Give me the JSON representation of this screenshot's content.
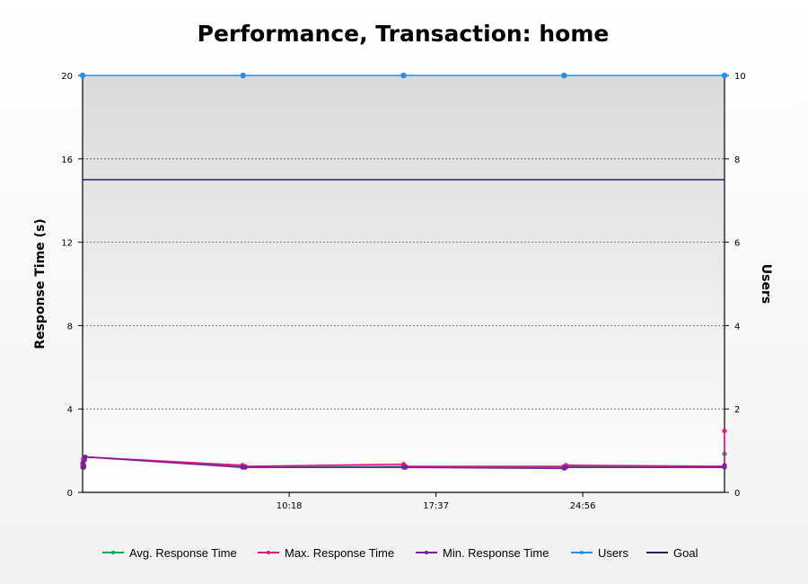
{
  "chart_data": {
    "type": "line",
    "title": "Performance, Transaction: home",
    "ylabel": "Response Time (s)",
    "y2label": "Users",
    "ylim": [
      0,
      20
    ],
    "y2lim": [
      0,
      10
    ],
    "yticks": [
      "0",
      "4",
      "8",
      "12",
      "16",
      "20"
    ],
    "y2ticks": [
      "0",
      "2",
      "4",
      "6",
      "8",
      "10"
    ],
    "xlim": [
      0,
      1920
    ],
    "xticks": [
      {
        "label": "10:18",
        "t": 618
      },
      {
        "label": "17:37",
        "t": 1057
      },
      {
        "label": "24:56",
        "t": 1496
      }
    ],
    "grid": true,
    "legend_position": "bottom",
    "series": [
      {
        "name": "Avg. Response Time",
        "color": "#00b050",
        "axis": "left",
        "x": [
          0,
          2,
          4,
          6,
          8,
          478,
          486,
          960,
          966,
          1440,
          1446,
          1920,
          1920
        ],
        "y": [
          1.3,
          1.5,
          1.25,
          1.6,
          1.7,
          1.25,
          1.2,
          1.25,
          1.2,
          1.2,
          1.25,
          1.25,
          1.85
        ]
      },
      {
        "name": "Max. Response Time",
        "color": "#e4167d",
        "axis": "left",
        "x": [
          0,
          2,
          4,
          6,
          8,
          478,
          486,
          960,
          966,
          1440,
          1446,
          1920,
          1920
        ],
        "y": [
          1.4,
          1.6,
          1.3,
          1.65,
          1.7,
          1.3,
          1.25,
          1.35,
          1.25,
          1.25,
          1.3,
          1.25,
          2.95
        ]
      },
      {
        "name": "Min. Response Time",
        "color": "#7b1fa2",
        "axis": "left",
        "x": [
          0,
          2,
          4,
          6,
          8,
          478,
          486,
          960,
          966,
          1440,
          1446,
          1920,
          1920
        ],
        "y": [
          1.2,
          1.4,
          1.2,
          1.55,
          1.7,
          1.2,
          1.2,
          1.2,
          1.2,
          1.15,
          1.2,
          1.2,
          1.3
        ]
      },
      {
        "name": "Users",
        "color": "#1e90ff",
        "axis": "right",
        "x": [
          0,
          480,
          960,
          1440,
          1920
        ],
        "y": [
          10,
          10,
          10,
          10,
          10
        ]
      },
      {
        "name": "Goal",
        "color": "#1f1f6e",
        "axis": "left",
        "x": [
          0,
          480,
          960,
          1440,
          1920
        ],
        "y": [
          15,
          15,
          15,
          15,
          15
        ]
      }
    ]
  }
}
